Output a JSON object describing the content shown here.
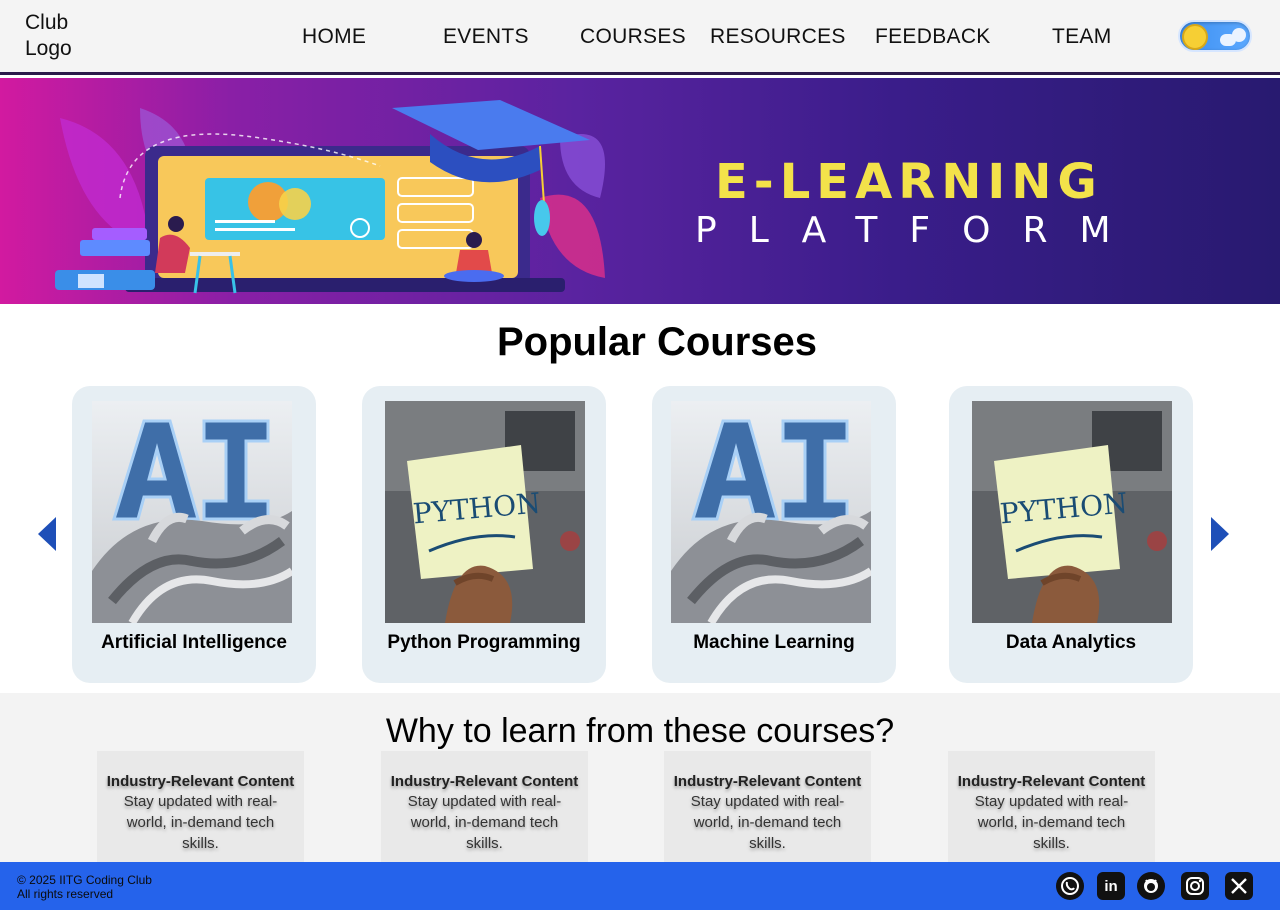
{
  "nav": {
    "logo": "Club\nLogo",
    "items": [
      "HOME",
      "EVENTS",
      "COURSES",
      "RESOURCES",
      "FEEDBACK",
      "TEAM"
    ],
    "theme_toggle": "light"
  },
  "hero": {
    "title": "E-LEARNING",
    "subtitle": "PLATFORM"
  },
  "courses": {
    "title": "Popular Courses",
    "items": [
      {
        "label": "Artificial Intelligence",
        "image": "ai"
      },
      {
        "label": "Python Programming",
        "image": "python"
      },
      {
        "label": "Machine Learning",
        "image": "ai"
      },
      {
        "label": "Data Analytics",
        "image": "python"
      }
    ]
  },
  "why": {
    "title": "Why to learn from these courses?",
    "features": [
      {
        "heading": "Industry-Relevant Content",
        "text": "Stay updated with real-world, in-demand tech skills."
      },
      {
        "heading": "Industry-Relevant Content",
        "text": "Stay updated with real-world, in-demand tech skills."
      },
      {
        "heading": "Industry-Relevant Content",
        "text": "Stay updated with real-world, in-demand tech skills."
      },
      {
        "heading": "Industry-Relevant Content",
        "text": "Stay updated with real-world, in-demand tech skills."
      }
    ]
  },
  "footer": {
    "copyright": "© 2025 IITG Coding Club",
    "rights": "All rights reserved",
    "social": [
      "whatsapp-icon",
      "linkedin-icon",
      "github-icon",
      "instagram-icon",
      "x-icon"
    ]
  },
  "colors": {
    "footer_bg": "#2563eb",
    "accent_title": "#f3e24a",
    "arrow": "#1e4fb8"
  }
}
